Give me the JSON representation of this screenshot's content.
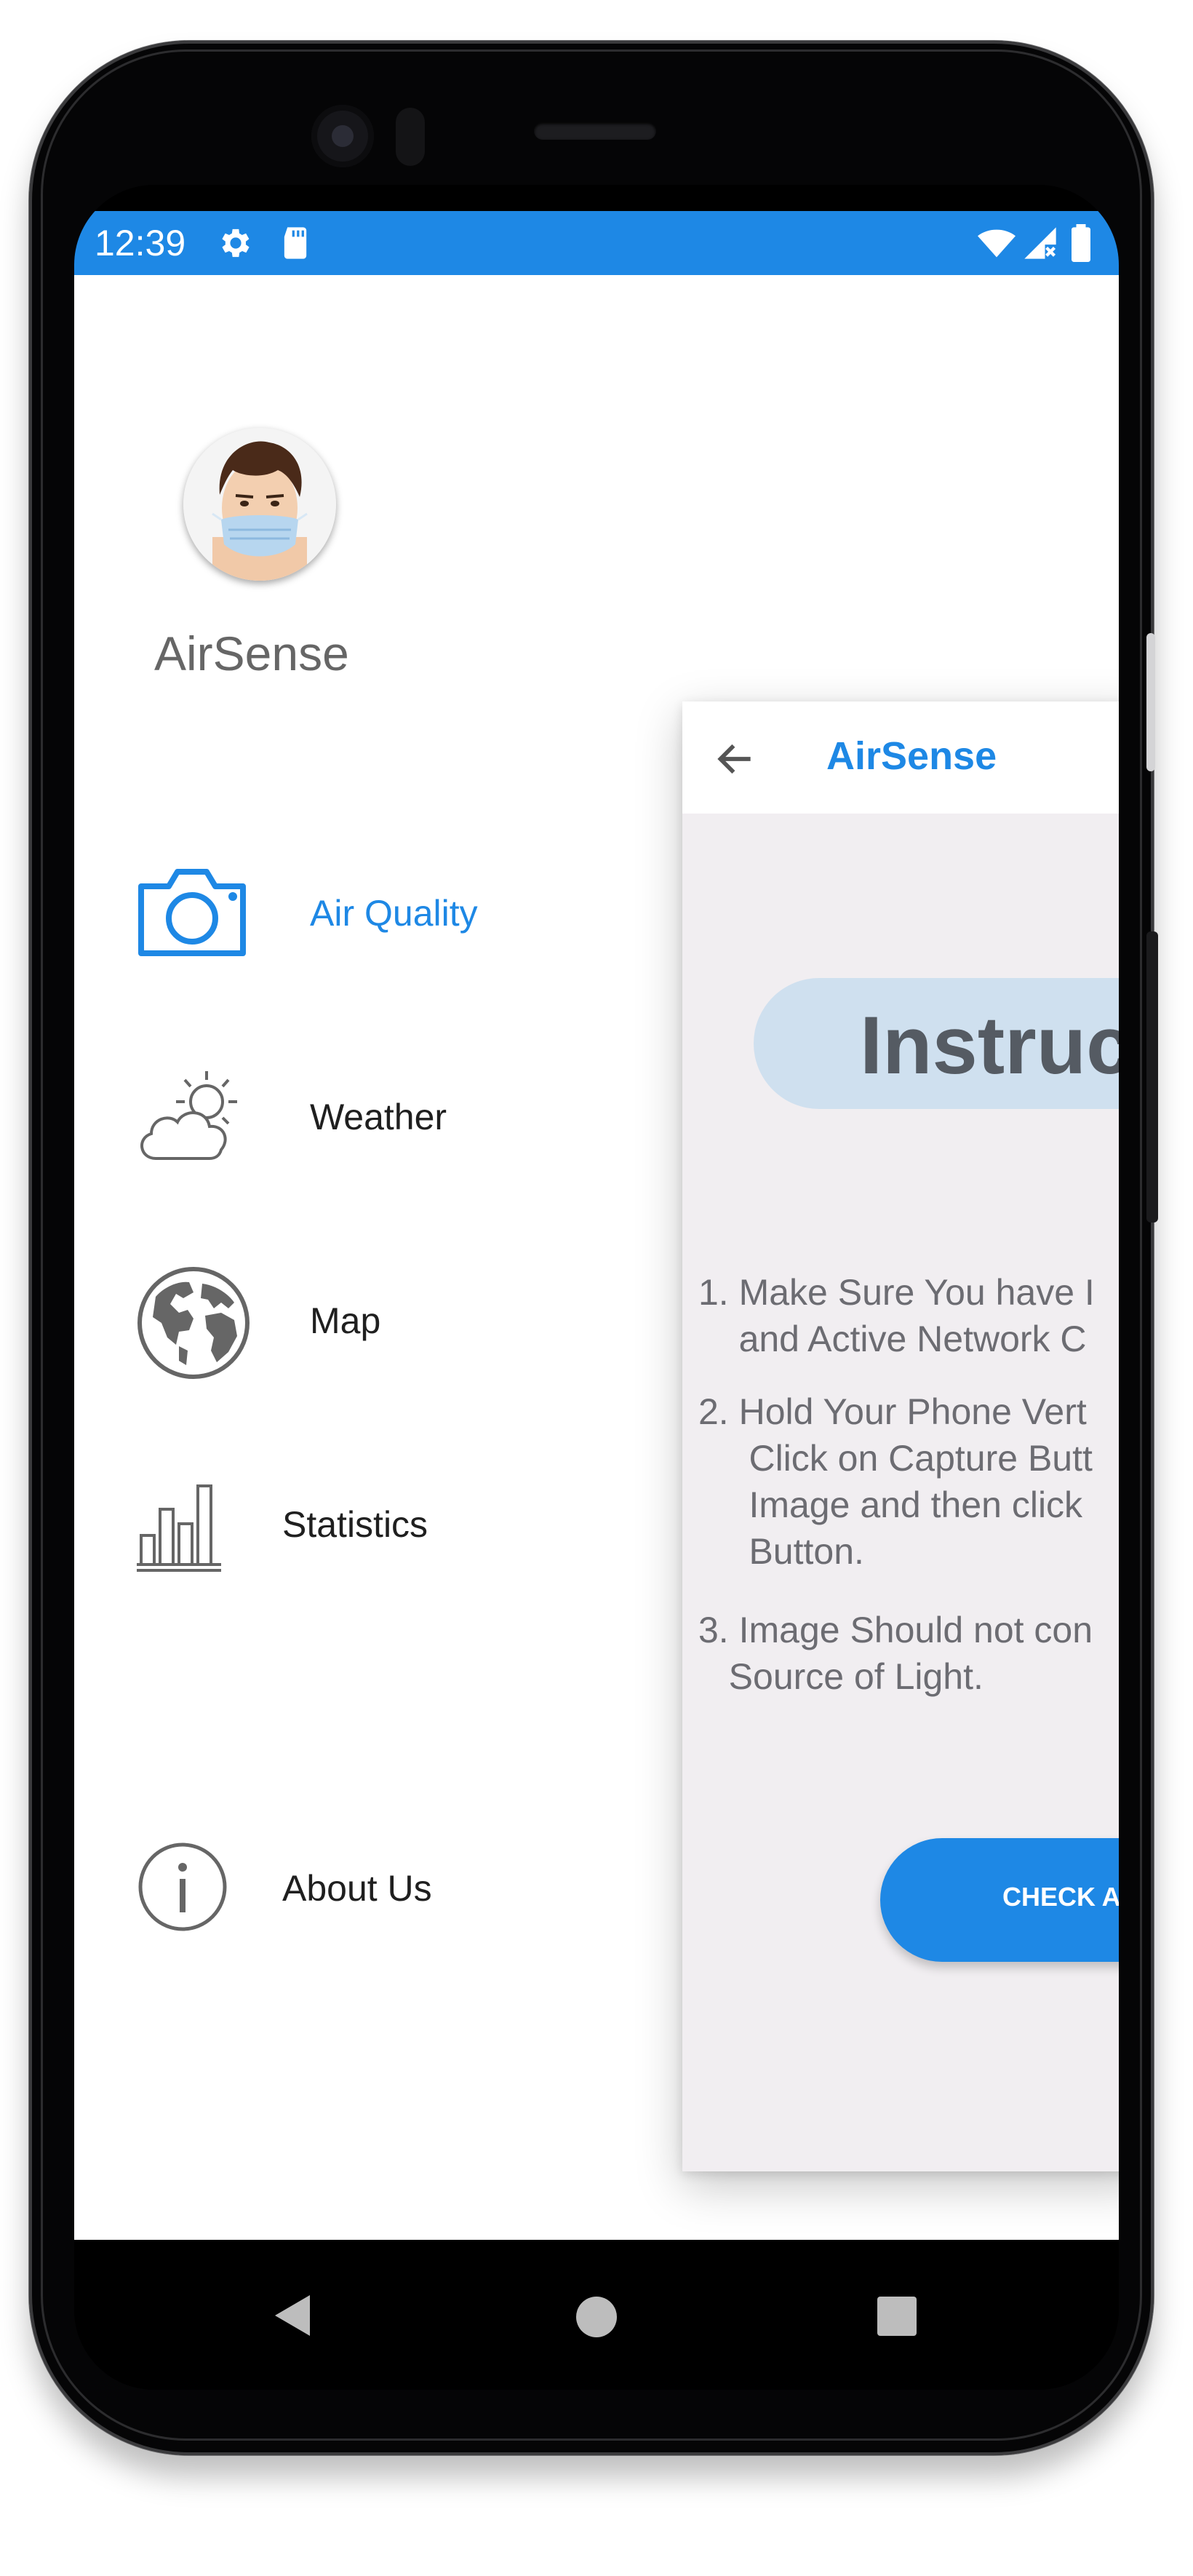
{
  "status_bar": {
    "time": "12:39",
    "icons_left": [
      "gear-icon",
      "sd-card-icon"
    ],
    "icons_right": [
      "wifi-icon",
      "signal-icon",
      "battery-icon"
    ],
    "color": "#1e88e5"
  },
  "drawer": {
    "app_name": "AirSense",
    "avatar": "masked-person-avatar",
    "items": [
      {
        "label": "Air Quality",
        "icon": "camera-icon",
        "active": true
      },
      {
        "label": "Weather",
        "icon": "cloud-sun-icon",
        "active": false
      },
      {
        "label": "Map",
        "icon": "globe-icon",
        "active": false
      },
      {
        "label": "Statistics",
        "icon": "bar-chart-icon",
        "active": false
      },
      {
        "label": "About Us",
        "icon": "info-icon",
        "active": false
      }
    ],
    "accent_color": "#1e88e5"
  },
  "main_card": {
    "app_bar_title": "AirSense",
    "heading": "Instruct",
    "instructions": [
      "1. Make Sure You have I\n    and Active Network C",
      "2. Hold Your Phone Vert\n     Click on Capture Butt\n     Image and then click\n     Button.",
      "3. Image Should not con\n   Source of Light."
    ],
    "button_label": "CHECK A"
  },
  "nav_bar": {
    "buttons": [
      "back-triangle-icon",
      "home-circle-icon",
      "recents-square-icon"
    ]
  }
}
